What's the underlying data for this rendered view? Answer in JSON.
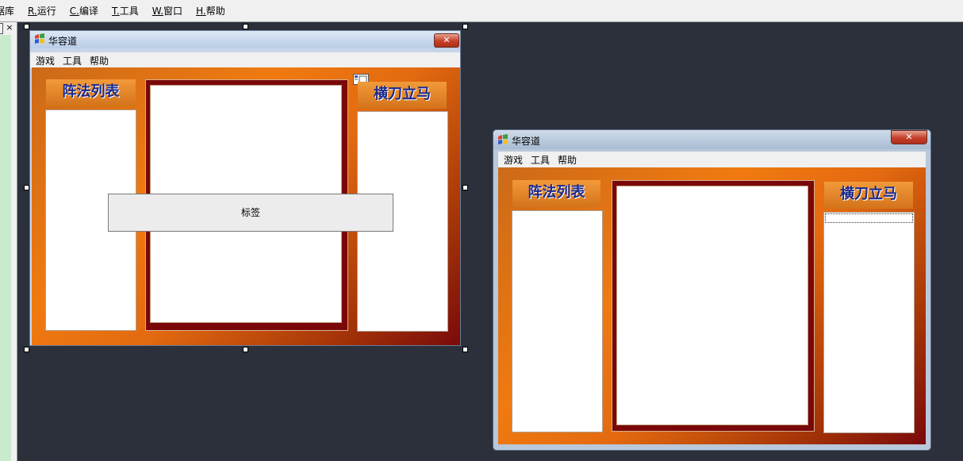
{
  "ide_menu": [
    {
      "prefix": "",
      "label": "据库"
    },
    {
      "prefix": "R.",
      "label": "运行"
    },
    {
      "prefix": "C.",
      "label": "编译"
    },
    {
      "prefix": "T.",
      "label": "工具"
    },
    {
      "prefix": "W.",
      "label": "窗口"
    },
    {
      "prefix": "H.",
      "label": "帮助"
    }
  ],
  "left_panel": {
    "close_glyph": "×"
  },
  "form_design": {
    "title": "华容道",
    "close_glyph": "✕",
    "menu": [
      "游戏",
      "工具",
      "帮助"
    ],
    "left_header": "阵法列表",
    "right_header": "横刀立马",
    "label_text": "标签"
  },
  "form_preview": {
    "title": "华容道",
    "close_glyph": "✕",
    "menu": [
      "游戏",
      "工具",
      "帮助"
    ],
    "left_header": "阵法列表",
    "right_header": "横刀立马"
  },
  "colors": {
    "desktop": "#2b303b",
    "orange": "#f07a10",
    "dark_red": "#7a0808",
    "header_text": "#1c2a8a"
  }
}
